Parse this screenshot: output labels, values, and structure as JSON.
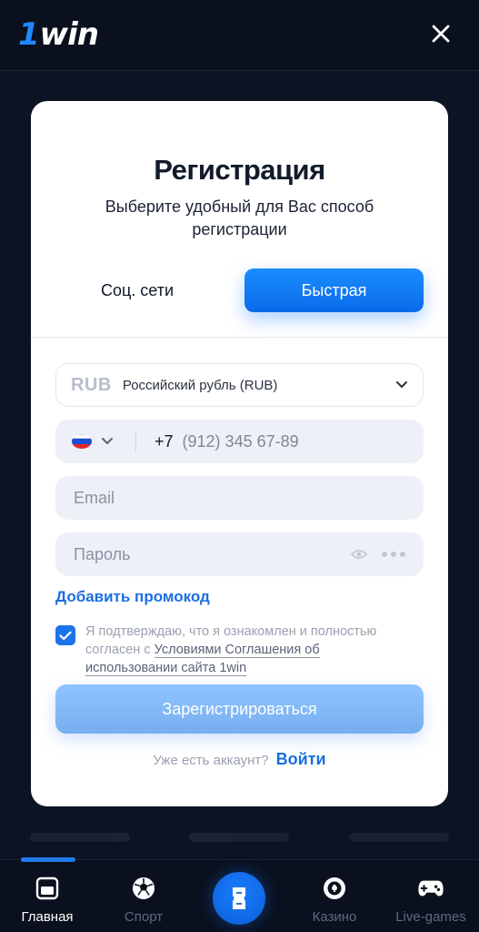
{
  "header": {
    "logo_prefix": "1",
    "logo_text": "win"
  },
  "modal": {
    "title": "Регистрация",
    "subtitle": "Выберите удобный для Вас способ регистрации",
    "tabs": [
      {
        "label": "Соц. сети",
        "active": false
      },
      {
        "label": "Быстрая",
        "active": true
      }
    ],
    "currency": {
      "code": "RUB",
      "name": "Российский рубль (RUB)"
    },
    "phone": {
      "country": "ru-flag",
      "prefix": "+7",
      "placeholder": "(912) 345 67-89",
      "value": ""
    },
    "email": {
      "placeholder": "Email",
      "value": ""
    },
    "password": {
      "placeholder": "Пароль",
      "value": ""
    },
    "promo_label": "Добавить промокод",
    "consent": {
      "checked": true,
      "text": "Я подтверждаю, что я ознакомлен и полностью согласен с ",
      "link": "Условиями Соглашения об использовании сайта 1win"
    },
    "submit_label": "Зарегистрироваться",
    "login_question": "Уже есть аккаунт?",
    "login_link": "Войти"
  },
  "bottom_nav": {
    "items": [
      {
        "label": "Главная",
        "icon": "home-icon",
        "active": true
      },
      {
        "label": "Спорт",
        "icon": "soccer-ball-icon",
        "active": false
      },
      {
        "label": "",
        "icon": "ticket-icon",
        "active": false
      },
      {
        "label": "Казино",
        "icon": "casino-chip-icon",
        "active": false
      },
      {
        "label": "Live-games",
        "icon": "gamepad-icon",
        "active": false
      }
    ]
  },
  "colors": {
    "accent": "#1a6fe0",
    "button_primary": "#0a6ae8",
    "background": "#0b1120"
  }
}
